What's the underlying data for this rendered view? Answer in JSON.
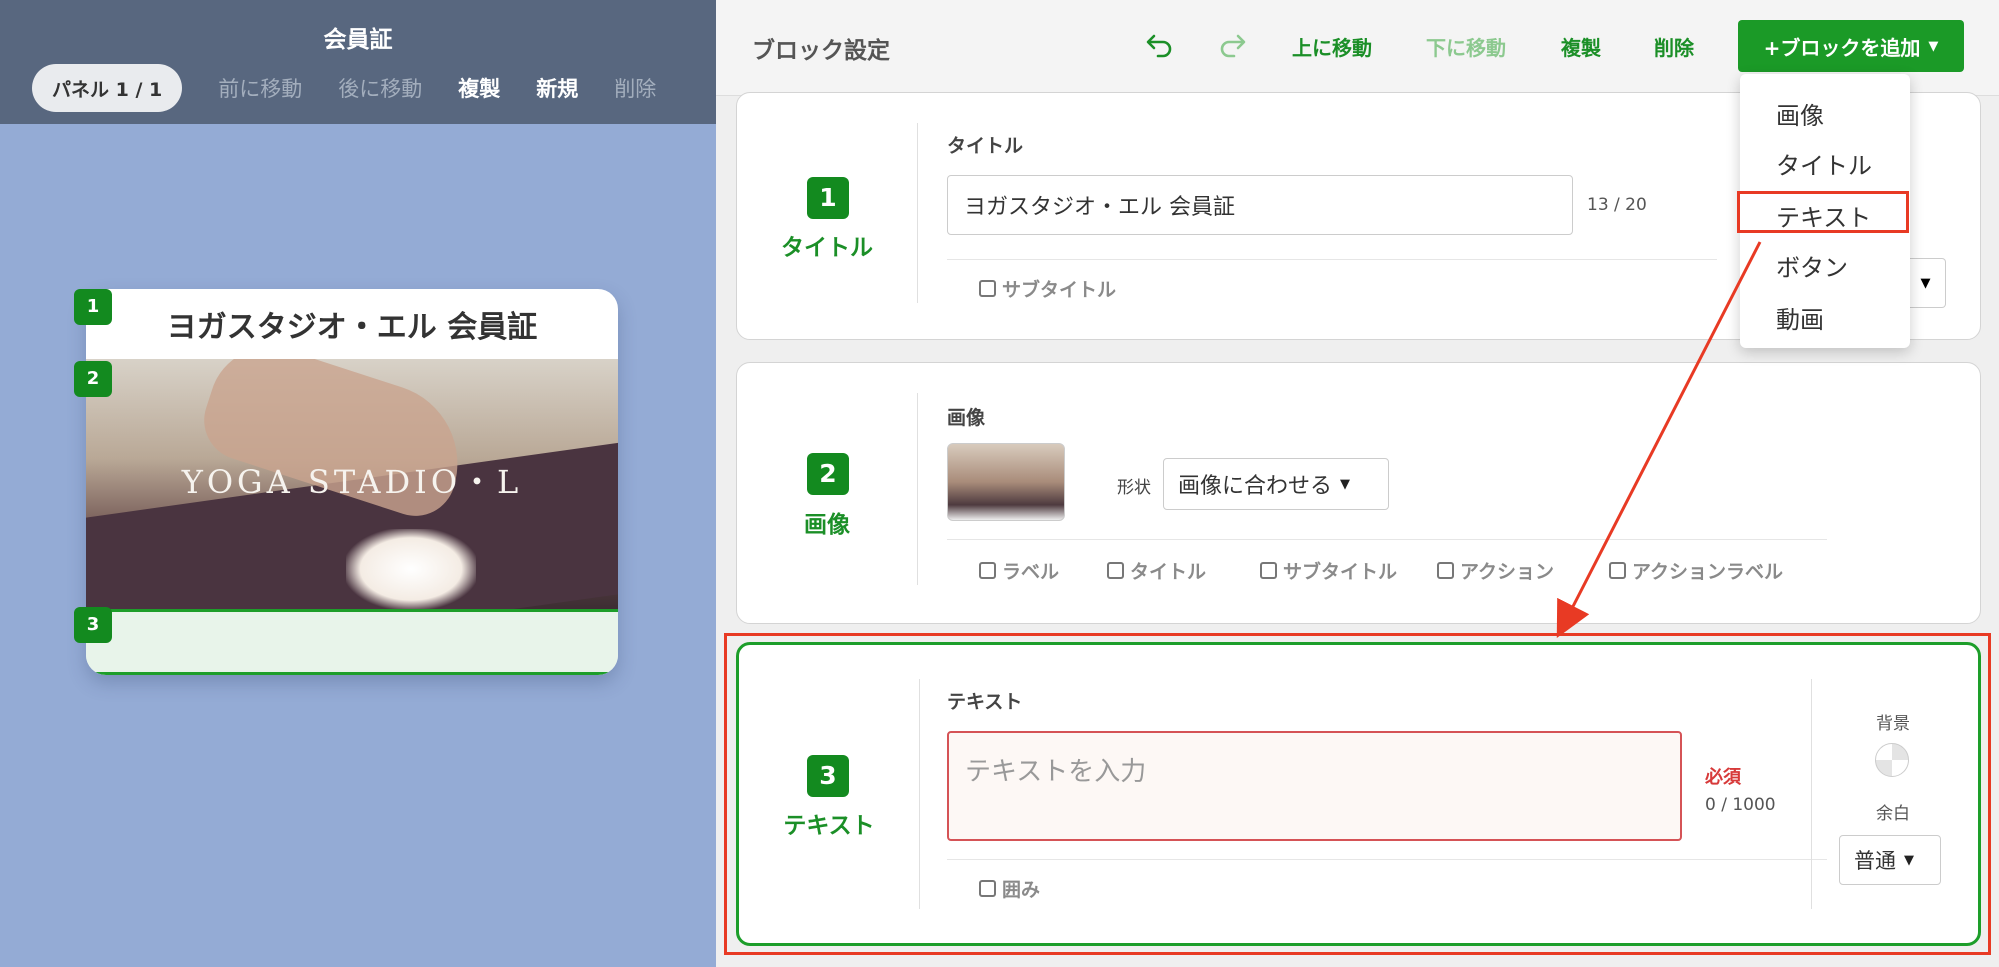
{
  "preview": {
    "title": "会員証",
    "panel_indicator": "パネル 1 / 1",
    "nav": {
      "move_forward": "前に移動",
      "move_back": "後に移動",
      "duplicate": "複製",
      "new": "新規",
      "delete": "削除"
    },
    "card": {
      "title": "ヨガスタジオ・エル 会員証",
      "image_text": "YOGA STADIO・L",
      "badges": [
        "1",
        "2",
        "3"
      ]
    }
  },
  "editor": {
    "title": "ブロック設定",
    "toolbar": {
      "move_up": "上に移動",
      "move_down": "下に移動",
      "duplicate": "複製",
      "delete": "削除",
      "add_block": "+ブロックを追加"
    },
    "add_menu": [
      "画像",
      "タイトル",
      "テキスト",
      "ボタン",
      "動画"
    ],
    "highlighted_menu_item": "テキスト",
    "blocks": [
      {
        "number": "1",
        "type_label": "タイトル",
        "field_label": "タイトル",
        "value": "ヨガスタジオ・エル 会員証",
        "count": "13 / 20",
        "options": [
          {
            "label": "サブタイトル",
            "checked": false
          }
        ]
      },
      {
        "number": "2",
        "type_label": "画像",
        "field_label": "画像",
        "shape_label": "形状",
        "shape_value": "画像に合わせる",
        "options": [
          {
            "label": "ラベル",
            "checked": false
          },
          {
            "label": "タイトル",
            "checked": false
          },
          {
            "label": "サブタイトル",
            "checked": false
          },
          {
            "label": "アクション",
            "checked": false
          },
          {
            "label": "アクションラベル",
            "checked": false
          }
        ]
      },
      {
        "number": "3",
        "type_label": "テキスト",
        "field_label": "テキスト",
        "placeholder": "テキストを入力",
        "required": "必須",
        "count": "0 / 1000",
        "options": [
          {
            "label": "囲み",
            "checked": false
          }
        ],
        "bg_label": "背景",
        "margin_label": "余白",
        "margin_value": "普通"
      }
    ]
  },
  "colors": {
    "brand_green": "#1b9a27",
    "highlight_red": "#e83a24",
    "required_red": "#d55356",
    "preview_bg": "#94abd5",
    "preview_header": "#58677f"
  },
  "icons": {
    "undo": "undo-icon",
    "redo": "redo-icon",
    "dropdown": "caret-down-icon"
  }
}
